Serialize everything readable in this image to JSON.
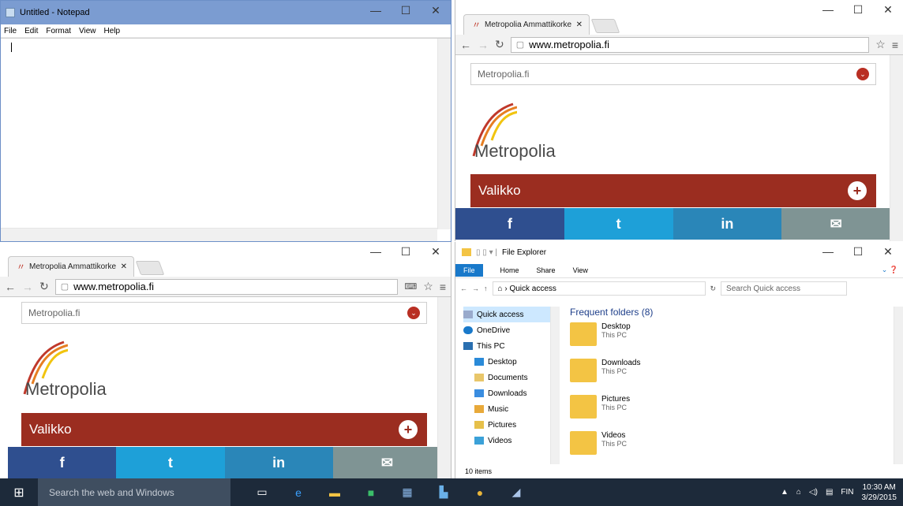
{
  "notepad": {
    "title": "Untitled - Notepad",
    "menu": [
      "File",
      "Edit",
      "Format",
      "View",
      "Help"
    ]
  },
  "browser_top": {
    "tab_title": "Metropolia Ammattikorke",
    "url": "www.metropolia.fi",
    "search_text": "Metropolia.fi",
    "logo_text": "Metropolia",
    "menu_label": "Valikko",
    "social": [
      "f",
      "t",
      "in",
      "✉"
    ]
  },
  "browser_bottom": {
    "tab_title": "Metropolia Ammattikorke",
    "url": "www.metropolia.fi",
    "search_text": "Metropolia.fi",
    "logo_text": "Metropolia",
    "menu_label": "Valikko",
    "social": [
      "f",
      "t",
      "in",
      "✉"
    ]
  },
  "explorer": {
    "title": "File Explorer",
    "ribbon": [
      "File",
      "Home",
      "Share",
      "View"
    ],
    "breadcrumb": "Quick access",
    "search_placeholder": "Search Quick access",
    "nav": [
      "Quick access",
      "OneDrive",
      "This PC",
      "Desktop",
      "Documents",
      "Downloads",
      "Music",
      "Pictures",
      "Videos"
    ],
    "group_label": "Frequent folders (8)",
    "folders": [
      {
        "name": "Desktop",
        "location": "This PC"
      },
      {
        "name": "Downloads",
        "location": "This PC"
      },
      {
        "name": "Pictures",
        "location": "This PC"
      },
      {
        "name": "Videos",
        "location": "This PC"
      }
    ],
    "status": "10 items"
  },
  "taskbar": {
    "search_placeholder": "Search the web and Windows",
    "language": "FIN",
    "time": "10:30 AM",
    "date": "3/29/2015"
  }
}
